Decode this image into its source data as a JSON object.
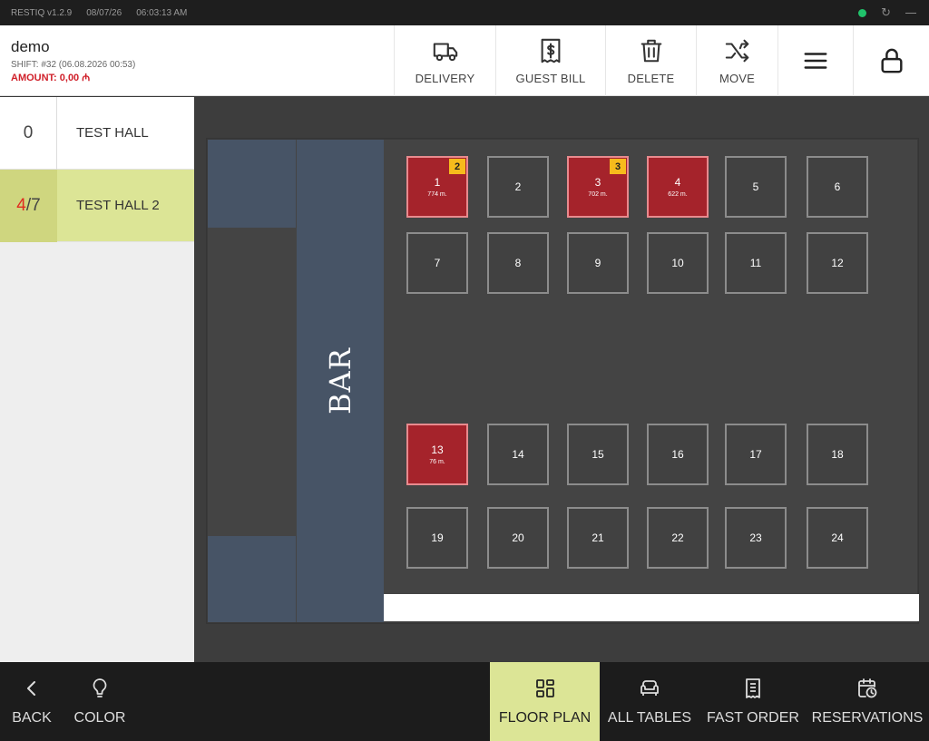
{
  "status_bar": {
    "app_version": "RESTIQ v1.2.9",
    "date": "08/07/26",
    "time": "06:03:13 AM",
    "connection_color": "#20c36b",
    "icons": [
      "connection-status-icon",
      "sync-icon",
      "minimize-icon"
    ]
  },
  "header": {
    "user_name": "demo",
    "shift": "SHIFT: #32 (06.08.2026 00:53)",
    "amount": "AMOUNT: 0,00 ₼",
    "actions": [
      {
        "label": "DELIVERY",
        "icon": "truck-icon"
      },
      {
        "label": "GUEST BILL",
        "icon": "receipt-dollar-icon"
      },
      {
        "label": "DELETE",
        "icon": "trash-icon"
      },
      {
        "label": "MOVE",
        "icon": "shuffle-icon"
      },
      {
        "label": "",
        "icon": "menu-icon"
      },
      {
        "label": "",
        "icon": "lock-icon"
      }
    ]
  },
  "halls": [
    {
      "count": "0",
      "name": "TEST HALL"
    },
    {
      "occupied": "4",
      "separator": "/",
      "total": "7",
      "name": "TEST HALL 2"
    }
  ],
  "floor": {
    "bar_label": "BAR",
    "tables": [
      {
        "number": "1",
        "amount": "774 m.",
        "badge": "2"
      },
      {
        "number": "2"
      },
      {
        "number": "3",
        "amount": "702 m.",
        "badge": "3"
      },
      {
        "number": "4",
        "amount": "622 m."
      },
      {
        "number": "5"
      },
      {
        "number": "6"
      },
      {
        "number": "7"
      },
      {
        "number": "8"
      },
      {
        "number": "9"
      },
      {
        "number": "10"
      },
      {
        "number": "11"
      },
      {
        "number": "12"
      },
      {
        "number": "13",
        "amount": "76 m."
      },
      {
        "number": "14"
      },
      {
        "number": "15"
      },
      {
        "number": "16"
      },
      {
        "number": "17"
      },
      {
        "number": "18"
      },
      {
        "number": "19"
      },
      {
        "number": "20"
      },
      {
        "number": "21"
      },
      {
        "number": "22"
      },
      {
        "number": "23"
      },
      {
        "number": "24"
      }
    ],
    "busy_color": "#a5232b",
    "badge_color": "#f7bb1c"
  },
  "bottom_nav": {
    "back": "BACK",
    "color": "COLOR",
    "floor_plan": "FLOOR PLAN",
    "all_tables": "ALL TABLES",
    "fast_order": "FAST ORDER",
    "reservations": "RESERVATIONS",
    "active_color": "#dce596"
  }
}
